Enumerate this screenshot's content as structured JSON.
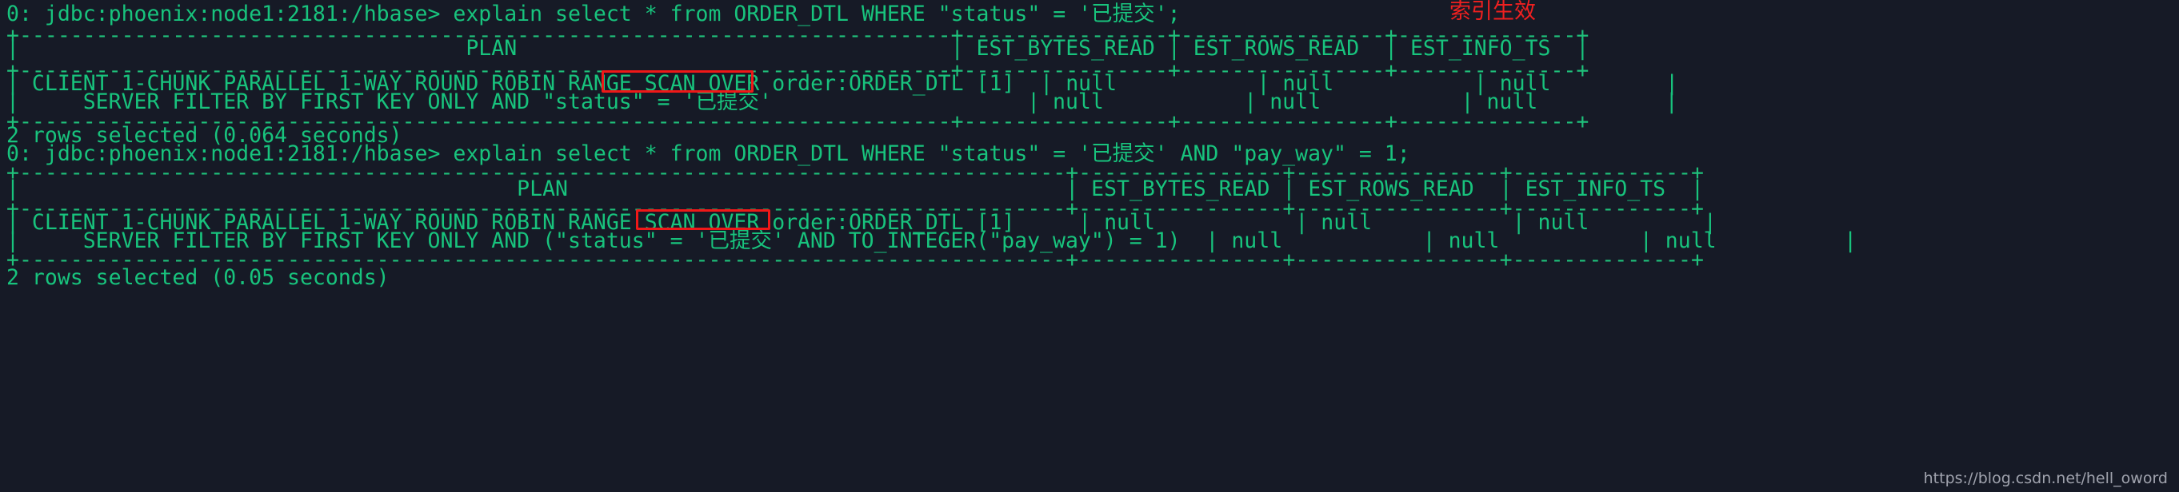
{
  "terminal": {
    "background_color": "#161a26",
    "text_color": "#18c37d",
    "annotation_color": "#ef2020",
    "highlight_box_color": "#f01818",
    "prompt": "0: jdbc:phoenix:node1:2181:/hbase>",
    "lines": [
      {
        "id": "l0",
        "text": "0: jdbc:phoenix:node1:2181:/hbase> explain select * from ORDER_DTL WHERE \"status\" = '已提交';"
      },
      {
        "id": "l1",
        "text": "+-------------------------------------------------------------------------+----------------+----------------+--------------+"
      },
      {
        "id": "l2",
        "text": "|                                   PLAN                                  | EST_BYTES_READ | EST_ROWS_READ  | EST_INFO_TS  |"
      },
      {
        "id": "l3",
        "text": "+-------------------------------------------------------------------------+----------------+----------------+--------------+"
      },
      {
        "id": "l4",
        "text": "| CLIENT 1-CHUNK PARALLEL 1-WAY ROUND ROBIN RANGE SCAN OVER order:ORDER_DTL [1]  | null           | null           | null         |"
      },
      {
        "id": "l5",
        "text": "|     SERVER FILTER BY FIRST KEY ONLY AND \"status\" = '已提交'                    | null           | null           | null          |"
      },
      {
        "id": "l6",
        "text": "+-------------------------------------------------------------------------+----------------+----------------+--------------+"
      },
      {
        "id": "l7",
        "text": "2 rows selected (0.064 seconds)"
      },
      {
        "id": "l8",
        "text": "0: jdbc:phoenix:node1:2181:/hbase> explain select * from ORDER_DTL WHERE \"status\" = '已提交' AND \"pay_way\" = 1;"
      },
      {
        "id": "l9",
        "text": "+----------------------------------------------------------------------------------+----------------+----------------+--------------+"
      },
      {
        "id": "l10",
        "text": "|                                       PLAN                                       | EST_BYTES_READ | EST_ROWS_READ  | EST_INFO_TS  |"
      },
      {
        "id": "l11",
        "text": "+----------------------------------------------------------------------------------+----------------+----------------+--------------+"
      },
      {
        "id": "l12",
        "text": "| CLIENT 1-CHUNK PARALLEL 1-WAY ROUND ROBIN RANGE SCAN OVER order:ORDER_DTL [1]     | null           | null           | null         |"
      },
      {
        "id": "l13",
        "text": "|     SERVER FILTER BY FIRST KEY ONLY AND (\"status\" = '已提交' AND TO_INTEGER(\"pay_way\") = 1)  | null           | null           | null          |"
      },
      {
        "id": "l14",
        "text": "+----------------------------------------------------------------------------------+----------------+----------------+--------------+"
      },
      {
        "id": "l15",
        "text": "2 rows selected (0.05 seconds)"
      }
    ],
    "annotations": [
      {
        "id": "a0",
        "text": "索引生效"
      }
    ],
    "highlights": [
      {
        "id": "h0",
        "label": "RANGE SCAN"
      },
      {
        "id": "h1",
        "label": "RANGE SCAN"
      }
    ],
    "watermark": "https://blog.csdn.net/hell_oword"
  },
  "queries": [
    {
      "sql": "explain select * from ORDER_DTL WHERE \"status\" = '已提交';",
      "columns": [
        "PLAN",
        "EST_BYTES_READ",
        "EST_ROWS_READ",
        "EST_INFO_TS"
      ],
      "rows": [
        {
          "plan": "CLIENT 1-CHUNK PARALLEL 1-WAY ROUND ROBIN RANGE SCAN OVER order:ORDER_DTL [1]",
          "est_bytes_read": "null",
          "est_rows_read": "null",
          "est_info_ts": "null"
        },
        {
          "plan": "    SERVER FILTER BY FIRST KEY ONLY AND \"status\" = '已提交'",
          "est_bytes_read": "null",
          "est_rows_read": "null",
          "est_info_ts": "null"
        }
      ],
      "result": "2 rows selected (0.064 seconds)"
    },
    {
      "sql": "explain select * from ORDER_DTL WHERE \"status\" = '已提交' AND \"pay_way\" = 1;",
      "columns": [
        "PLAN",
        "EST_BYTES_READ",
        "EST_ROWS_READ",
        "EST_INFO_TS"
      ],
      "rows": [
        {
          "plan": "CLIENT 1-CHUNK PARALLEL 1-WAY ROUND ROBIN RANGE SCAN OVER order:ORDER_DTL [1]",
          "est_bytes_read": "null",
          "est_rows_read": "null",
          "est_info_ts": "null"
        },
        {
          "plan": "    SERVER FILTER BY FIRST KEY ONLY AND (\"status\" = '已提交' AND TO_INTEGER(\"pay_way\") = 1)",
          "est_bytes_read": "null",
          "est_rows_read": "null",
          "est_info_ts": "null"
        }
      ],
      "result": "2 rows selected (0.05 seconds)"
    }
  ]
}
